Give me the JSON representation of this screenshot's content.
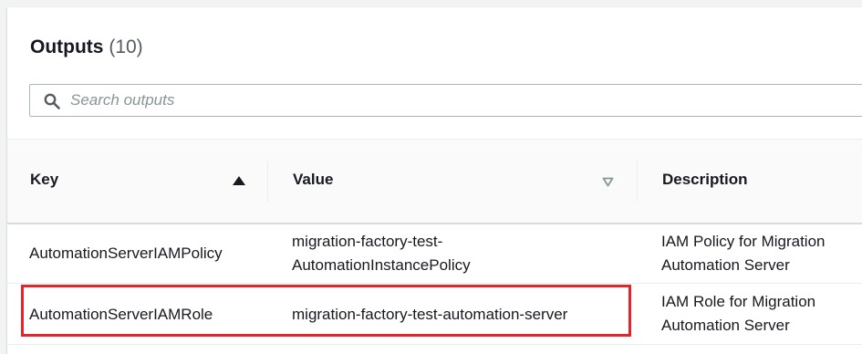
{
  "header": {
    "title": "Outputs",
    "count": "(10)"
  },
  "search": {
    "placeholder": "Search outputs",
    "value": ""
  },
  "table": {
    "columns": [
      {
        "label": "Key",
        "sort": "ascending"
      },
      {
        "label": "Value",
        "sort": "none"
      },
      {
        "label": "Description",
        "sort": "none"
      }
    ],
    "rows": [
      {
        "key": "AutomationServerIAMPolicy",
        "value_line1": "migration-factory-test-",
        "value_line2": "AutomationInstancePolicy",
        "desc_line1": "IAM Policy for Migration",
        "desc_line2": "Automation Server"
      },
      {
        "key": "AutomationServerIAMRole",
        "value_line1": "migration-factory-test-automation-server",
        "desc_line1": "IAM Role for Migration",
        "desc_line2": "Automation Server",
        "highlighted": true
      }
    ]
  },
  "colors": {
    "highlight": "#e2242c",
    "text": "#16191f",
    "muted": "#545b64",
    "placeholder": "#879596"
  },
  "icons": [
    "search-icon",
    "sort-ascending-icon",
    "sort-descending-icon"
  ]
}
